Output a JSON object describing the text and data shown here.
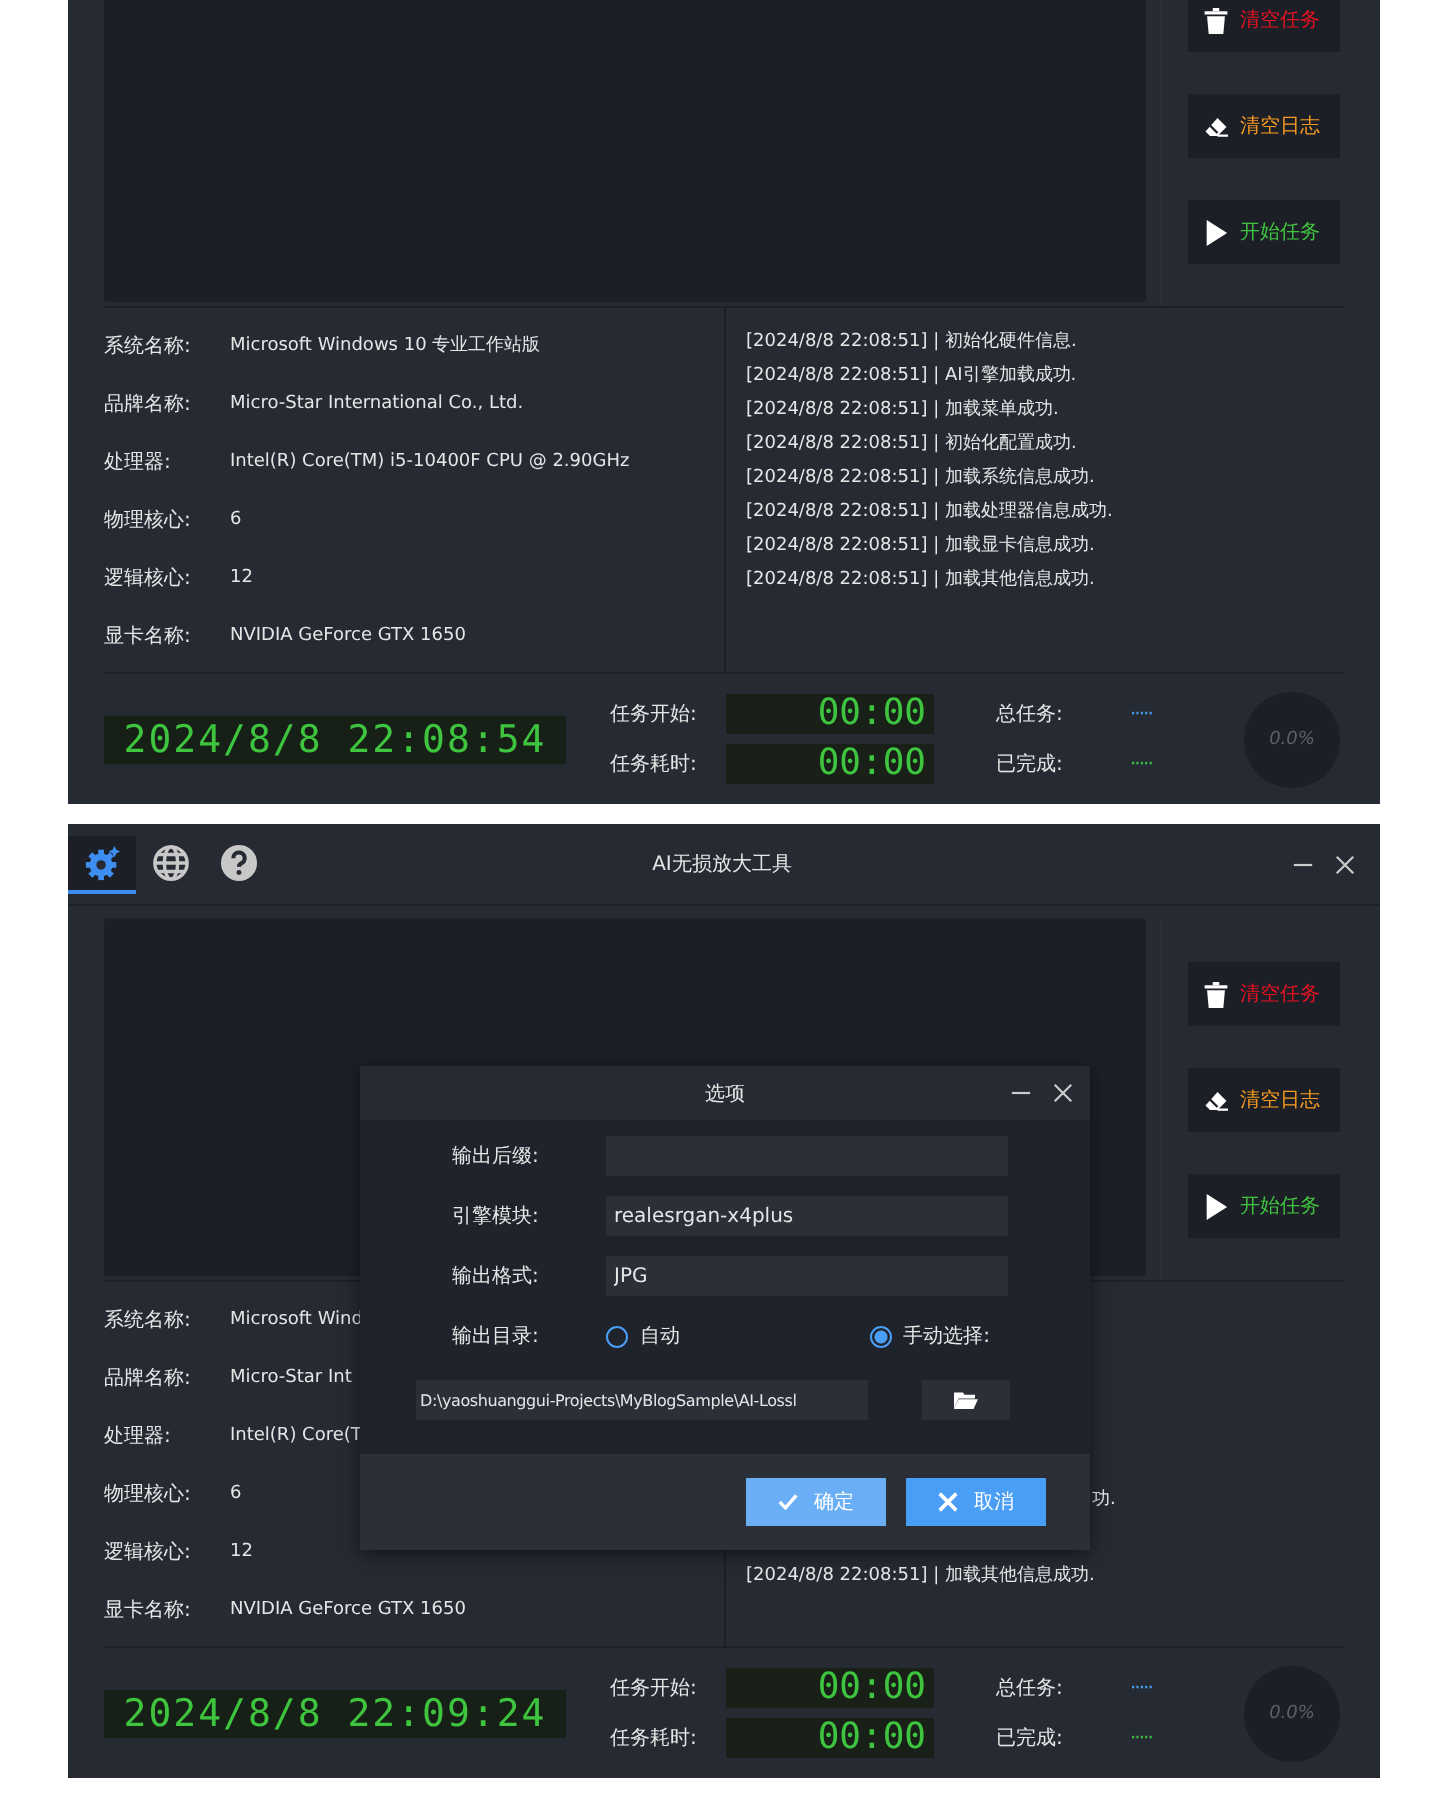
{
  "screens": [
    {
      "kind": "main",
      "actions": [
        {
          "kind": "clear-tasks",
          "label": "清空任务"
        },
        {
          "kind": "clear-log",
          "label": "清空日志"
        },
        {
          "kind": "start",
          "label": "开始任务"
        }
      ],
      "system_info": [
        {
          "label": "系统名称:",
          "value": "Microsoft Windows 10 专业工作站版"
        },
        {
          "label": "品牌名称:",
          "value": "Micro-Star International Co., Ltd."
        },
        {
          "label": "处理器:",
          "value": "Intel(R) Core(TM) i5-10400F CPU @ 2.90GHz"
        },
        {
          "label": "物理核心:",
          "value": "6"
        },
        {
          "label": "逻辑核心:",
          "value": "12"
        },
        {
          "label": "显卡名称:",
          "value": "NVIDIA GeForce GTX 1650"
        }
      ],
      "log": [
        {
          "kind": "line",
          "text": "[2024/8/8 22:08:51] | 初始化硬件信息."
        },
        {
          "kind": "line",
          "text": "[2024/8/8 22:08:51] | AI引擎加载成功."
        },
        {
          "kind": "line",
          "text": "[2024/8/8 22:08:51] | 加载菜单成功."
        },
        {
          "kind": "line",
          "text": "[2024/8/8 22:08:51] | 初始化配置成功."
        },
        {
          "kind": "line",
          "text": "[2024/8/8 22:08:51] | 加载系统信息成功."
        },
        {
          "kind": "line",
          "text": "[2024/8/8 22:08:51] | 加载处理器信息成功."
        },
        {
          "kind": "line",
          "text": "[2024/8/8 22:08:51] | 加载显卡信息成功."
        },
        {
          "kind": "line",
          "text": "[2024/8/8 22:08:51] | 加载其他信息成功."
        }
      ],
      "clock": "2024/8/8 22:08:54",
      "task_start": {
        "label": "任务开始:",
        "time": "00:00"
      },
      "task_elapsed": {
        "label": "任务耗时:",
        "time": "00:00"
      },
      "total_tasks": {
        "label": "总任务:",
        "value": "·····"
      },
      "completed": {
        "label": "已完成:",
        "value": "·····"
      },
      "progress": "0.0%"
    },
    {
      "kind": "main",
      "title_bar": {
        "tabs": [
          {
            "kind": "settings",
            "selected": true
          },
          {
            "kind": "language",
            "selected": false
          },
          {
            "kind": "help",
            "selected": false
          }
        ],
        "title": "AI无损放大工具"
      },
      "actions": [
        {
          "kind": "clear-tasks",
          "label": "清空任务"
        },
        {
          "kind": "clear-log",
          "label": "清空日志"
        },
        {
          "kind": "start",
          "label": "开始任务"
        }
      ],
      "system_info": [
        {
          "label": "系统名称:",
          "value": "Microsoft Wind"
        },
        {
          "label": "品牌名称:",
          "value": "Micro-Star Int"
        },
        {
          "label": "处理器:",
          "value": "Intel(R) Core(T"
        },
        {
          "label": "物理核心:",
          "value": "6"
        },
        {
          "label": "逻辑核心:",
          "value": "12"
        },
        {
          "label": "显卡名称:",
          "value": "NVIDIA GeForce GTX 1650"
        }
      ],
      "log": [
        {
          "kind": "fragment",
          "text": "功."
        },
        {
          "kind": "line",
          "text": "[2024/8/8 22:08:51] | 加载其他信息成功."
        }
      ],
      "clock": "2024/8/8 22:09:24",
      "task_start": {
        "label": "任务开始:",
        "time": "00:00"
      },
      "task_elapsed": {
        "label": "任务耗时:",
        "time": "00:00"
      },
      "total_tasks": {
        "label": "总任务:",
        "value": "·····"
      },
      "completed": {
        "label": "已完成:",
        "value": "·····"
      },
      "progress": "0.0%",
      "dialog": {
        "title": "选项",
        "fields": [
          {
            "label": "输出后缀:"
          },
          {
            "label": "引擎模块:",
            "value": "realesrgan-x4plus"
          },
          {
            "label": "输出格式:",
            "value": "JPG"
          }
        ],
        "output_dir": {
          "label": "输出目录:",
          "options": [
            {
              "label": "自动",
              "selected": false
            },
            {
              "label": "手动选择:",
              "selected": true
            }
          ],
          "path": "D:\\yaoshuanggui-Projects\\MyBlogSample\\AI-Lossl"
        },
        "buttons": [
          {
            "kind": "ok",
            "label": "确定"
          },
          {
            "kind": "cancel",
            "label": "取消"
          }
        ]
      }
    }
  ]
}
